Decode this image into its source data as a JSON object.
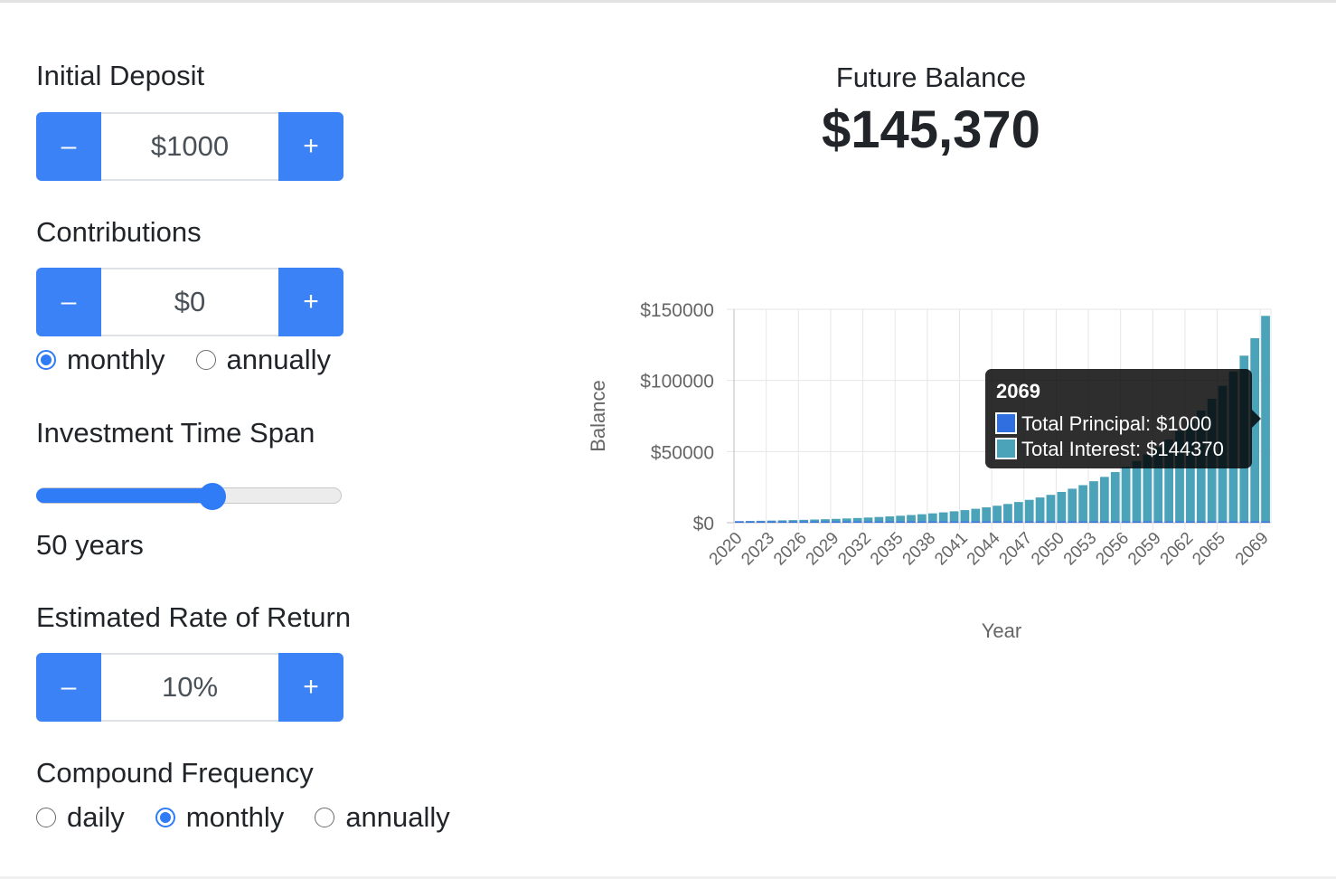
{
  "inputs": {
    "initial_deposit": {
      "label": "Initial Deposit",
      "value": "$1000",
      "minus": "–",
      "plus": "+"
    },
    "contributions": {
      "label": "Contributions",
      "value": "$0",
      "minus": "–",
      "plus": "+",
      "frequency": {
        "options": [
          "monthly",
          "annually"
        ],
        "selected": "monthly"
      }
    },
    "time_span": {
      "label": "Investment Time Span",
      "value_text": "50 years",
      "slider_fraction": 0.59
    },
    "rate": {
      "label": "Estimated Rate of Return",
      "value": "10%",
      "minus": "–",
      "plus": "+"
    },
    "compound": {
      "label": "Compound Frequency",
      "options": [
        "daily",
        "monthly",
        "annually"
      ],
      "selected": "monthly"
    }
  },
  "result": {
    "title": "Future Balance",
    "value": "$145,370"
  },
  "colors": {
    "accent": "#3b82f6",
    "principal": "#2f6fe0",
    "interest": "#4aa3b8"
  },
  "tooltip": {
    "year": "2069",
    "lines": [
      "Total Principal: $1000",
      "Total Interest: $144370"
    ]
  },
  "chart_data": {
    "type": "bar",
    "stacked": true,
    "xlabel": "Year",
    "ylabel": "Balance",
    "ylim": [
      0,
      150000
    ],
    "yticks": [
      "$0",
      "$50000",
      "$100000",
      "$150000"
    ],
    "ytick_values": [
      0,
      50000,
      100000,
      150000
    ],
    "x": [
      2020,
      2021,
      2022,
      2023,
      2024,
      2025,
      2026,
      2027,
      2028,
      2029,
      2030,
      2031,
      2032,
      2033,
      2034,
      2035,
      2036,
      2037,
      2038,
      2039,
      2040,
      2041,
      2042,
      2043,
      2044,
      2045,
      2046,
      2047,
      2048,
      2049,
      2050,
      2051,
      2052,
      2053,
      2054,
      2055,
      2056,
      2057,
      2058,
      2059,
      2060,
      2061,
      2062,
      2063,
      2064,
      2065,
      2066,
      2067,
      2068,
      2069
    ],
    "xtick_labels": [
      "2020",
      "2023",
      "2026",
      "2029",
      "2032",
      "2035",
      "2038",
      "2041",
      "2044",
      "2047",
      "2050",
      "2053",
      "2056",
      "2059",
      "2062",
      "2065",
      "2069"
    ],
    "series": [
      {
        "name": "Total Principal",
        "values": [
          1000,
          1000,
          1000,
          1000,
          1000,
          1000,
          1000,
          1000,
          1000,
          1000,
          1000,
          1000,
          1000,
          1000,
          1000,
          1000,
          1000,
          1000,
          1000,
          1000,
          1000,
          1000,
          1000,
          1000,
          1000,
          1000,
          1000,
          1000,
          1000,
          1000,
          1000,
          1000,
          1000,
          1000,
          1000,
          1000,
          1000,
          1000,
          1000,
          1000,
          1000,
          1000,
          1000,
          1000,
          1000,
          1000,
          1000,
          1000,
          1000,
          1000
        ]
      },
      {
        "name": "Total Interest",
        "values": [
          105,
          221,
          348,
          489,
          645,
          817,
          1006,
          1214,
          1444,
          1698,
          1978,
          2287,
          2629,
          3006,
          3422,
          3882,
          4390,
          4951,
          5571,
          6256,
          7012,
          7847,
          8770,
          9789,
          10915,
          12159,
          13533,
          15051,
          16728,
          18580,
          20626,
          22887,
          25384,
          28143,
          31191,
          34559,
          38278,
          42388,
          46927,
          51942,
          57482,
          63603,
          70365,
          77834,
          86086,
          95202,
          105273,
          116397,
          128687,
          144370
        ]
      }
    ]
  }
}
